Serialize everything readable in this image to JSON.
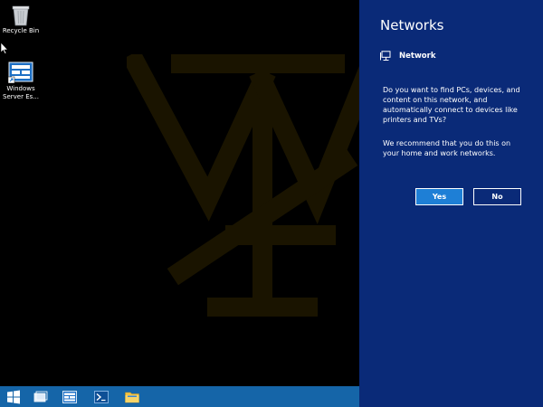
{
  "desktop": {
    "icons": [
      {
        "label": "Recycle Bin",
        "icon": "recycle-bin-icon"
      },
      {
        "label": "Windows Server Es...",
        "icon": "server-essentials-dashboard-icon"
      }
    ],
    "wallpaper": {
      "icon": "monogram-logo"
    }
  },
  "taskbar": {
    "color": "#1565a8",
    "buttons": [
      {
        "icon": "windows-start-icon"
      },
      {
        "icon": "task-view-icon"
      },
      {
        "icon": "server-manager-icon"
      },
      {
        "icon": "powershell-icon"
      },
      {
        "icon": "file-explorer-icon"
      }
    ]
  },
  "networks_pane": {
    "background": "#0a2a78",
    "title": "Networks",
    "network": {
      "icon": "wired-network-icon",
      "name": "Network"
    },
    "prompt": "Do you want to find PCs, devices, and content on this network, and automatically connect to devices like printers and TVs?",
    "recommendation": "We recommend that you do this on your home and work networks.",
    "yes_label": "Yes",
    "no_label": "No",
    "accent": "#1e7fd6"
  }
}
